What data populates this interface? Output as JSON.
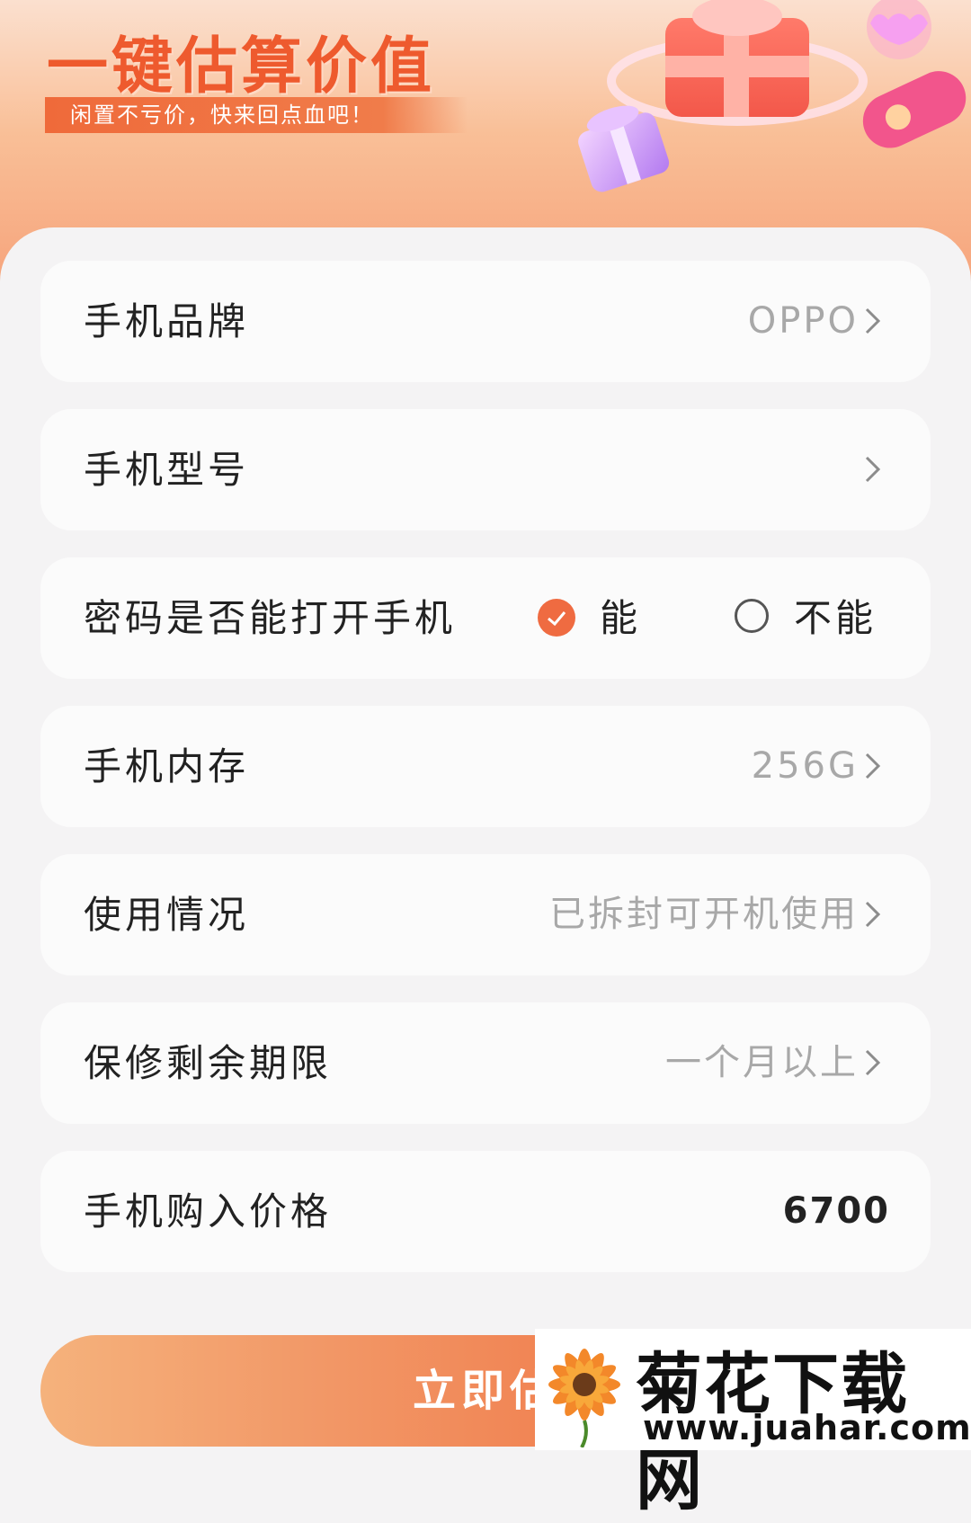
{
  "banner": {
    "title": "一键估算价值",
    "subtitle": "闲置不亏价，快来回点血吧！"
  },
  "form": {
    "rows": [
      {
        "label": "手机品牌",
        "value": "OPPO"
      },
      {
        "label": "手机型号",
        "value": ""
      },
      {
        "label": "密码是否能打开手机",
        "option_yes": "能",
        "option_no": "不能",
        "selected": "能"
      },
      {
        "label": "手机内存",
        "value": "256G"
      },
      {
        "label": "使用情况",
        "value": "已拆封可开机使用"
      },
      {
        "label": "保修剩余期限",
        "value": "一个月以上"
      },
      {
        "label": "手机购入价格",
        "value": "6700"
      }
    ]
  },
  "cta": {
    "label": "立即估"
  },
  "watermark": {
    "title": "菊花下载网",
    "url": "www.juahar.com"
  },
  "colors": {
    "accent": "#ef6b41",
    "card": "#fbfbfb",
    "background": "#f4f3f4"
  }
}
